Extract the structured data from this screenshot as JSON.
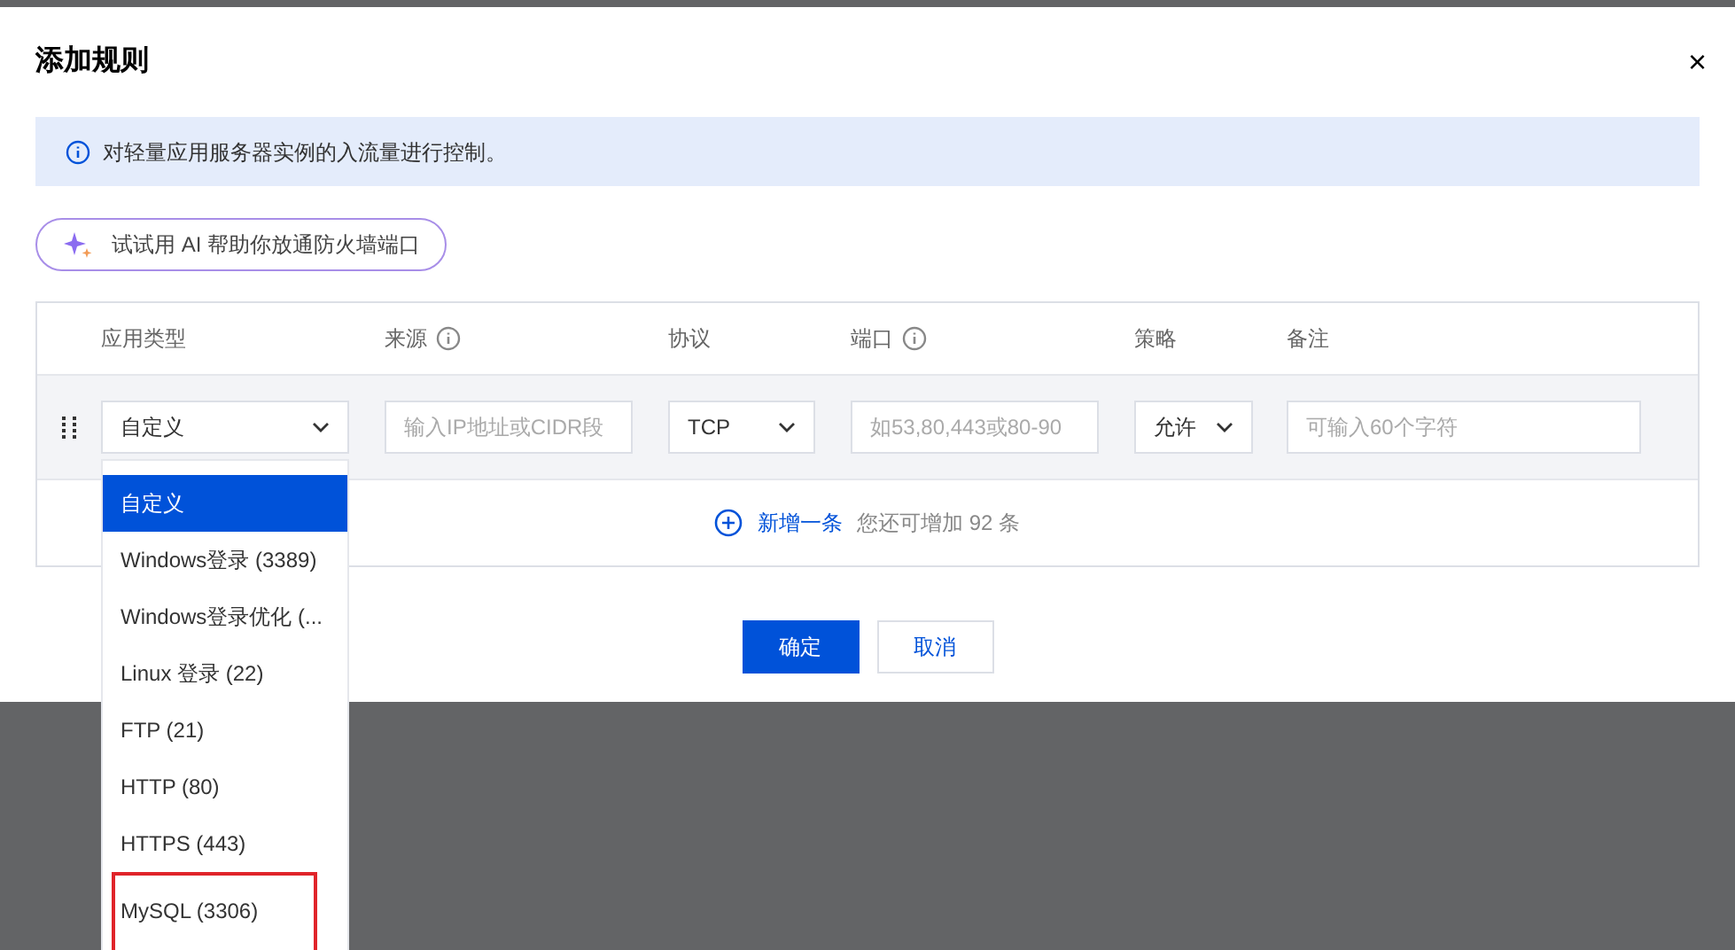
{
  "dialog": {
    "title": "添加规则",
    "close": "×"
  },
  "info": "对轻量应用服务器实例的入流量进行控制。",
  "ai_button": "试试用 AI 帮助你放通防火墙端口",
  "table": {
    "columns": [
      {
        "label": "应用类型",
        "info": false
      },
      {
        "label": "来源",
        "info": true
      },
      {
        "label": "协议",
        "info": false
      },
      {
        "label": "端口",
        "info": true
      },
      {
        "label": "策略",
        "info": false
      },
      {
        "label": "备注",
        "info": false
      }
    ],
    "row": {
      "app_type": "自定义",
      "source_placeholder": "输入IP地址或CIDR段",
      "protocol": "TCP",
      "port_placeholder": "如53,80,443或80-90",
      "policy": "允许",
      "note_placeholder": "可输入60个字符"
    },
    "add": {
      "label": "新增一条",
      "hint": "您还可增加 92 条"
    }
  },
  "buttons": [
    {
      "label": "确定",
      "kind": "primary"
    },
    {
      "label": "取消",
      "kind": "secondary"
    }
  ],
  "dropdown": [
    {
      "label": "自定义",
      "selected": true,
      "highlighted": false
    },
    {
      "label": "Windows登录 (3389)",
      "selected": false,
      "highlighted": false
    },
    {
      "label": "Windows登录优化 (...",
      "selected": false,
      "highlighted": false
    },
    {
      "label": "Linux 登录 (22)",
      "selected": false,
      "highlighted": false
    },
    {
      "label": "FTP (21)",
      "selected": false,
      "highlighted": false
    },
    {
      "label": "HTTP (80)",
      "selected": false,
      "highlighted": false
    },
    {
      "label": "HTTPS (443)",
      "selected": false,
      "highlighted": false
    },
    {
      "label": "MySQL (3306)",
      "selected": false,
      "highlighted": true
    }
  ]
}
